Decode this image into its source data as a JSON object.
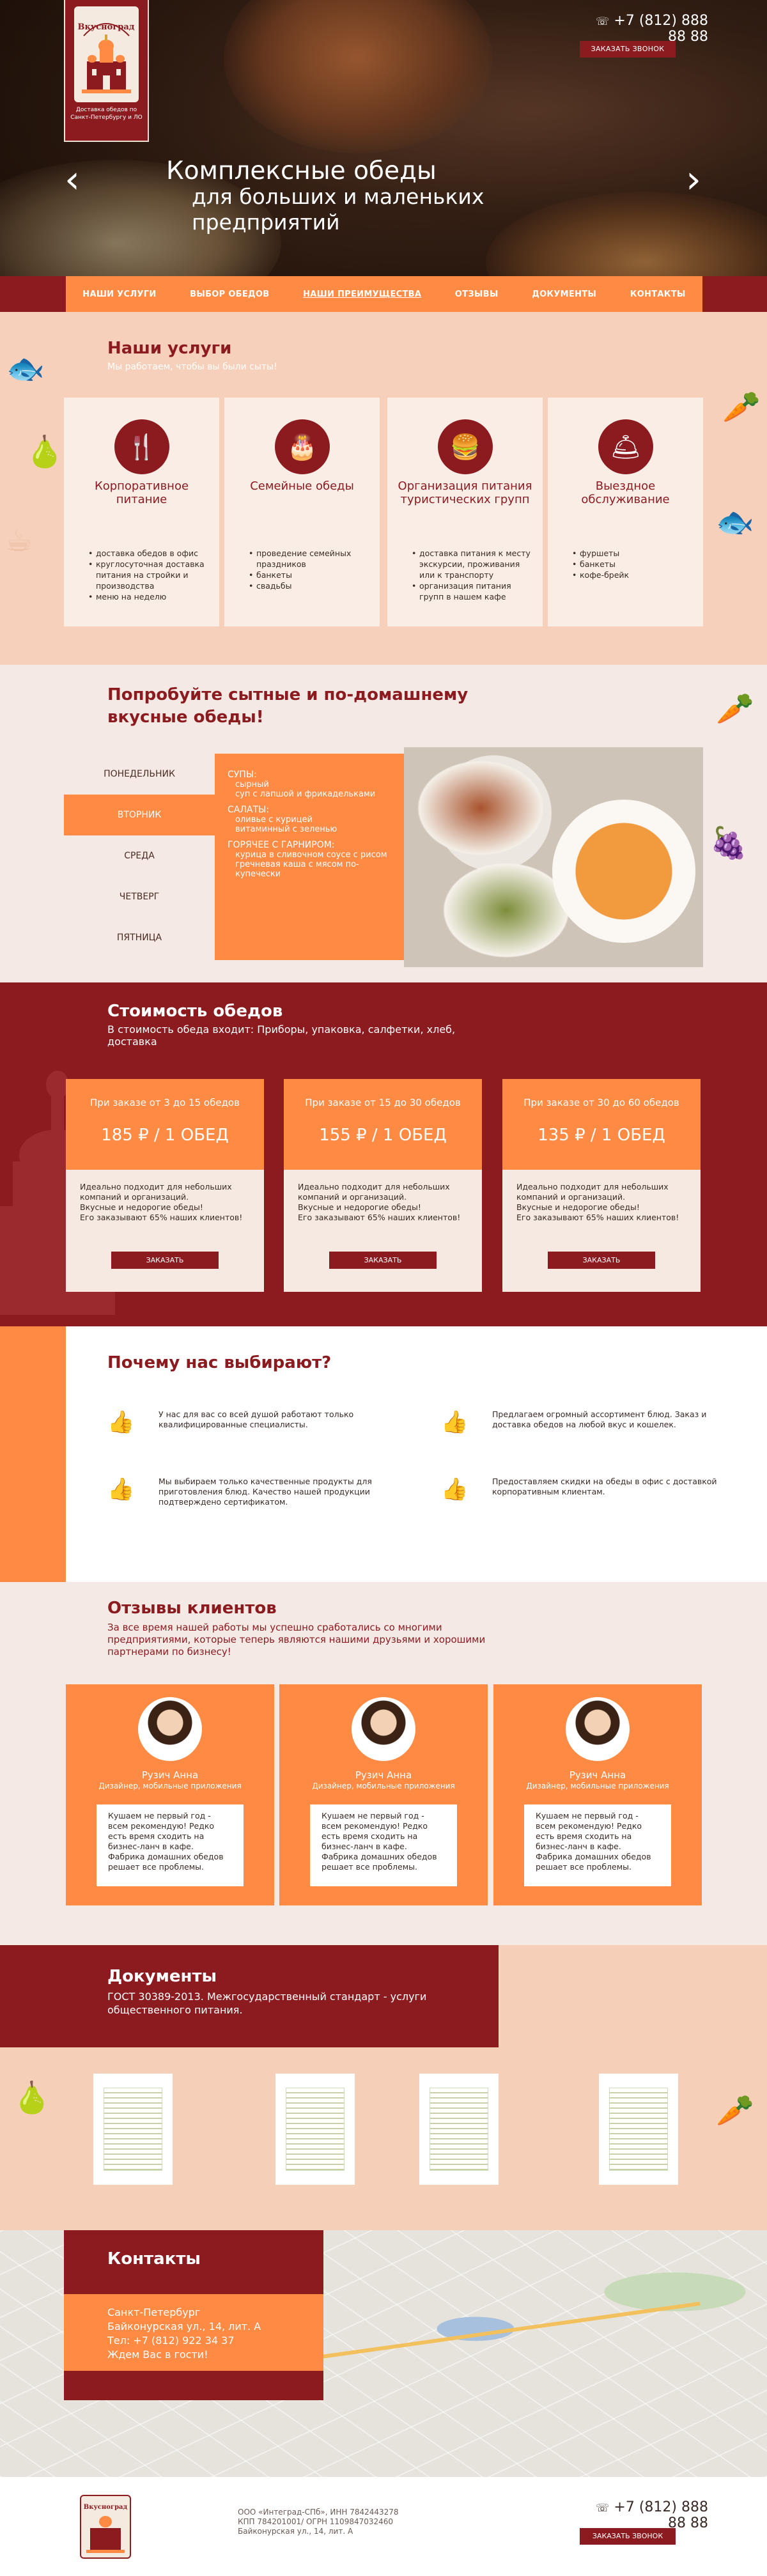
{
  "colors": {
    "burgundy": "#8c1b20",
    "orange": "#ff8a43",
    "peach": "#f6d0ba",
    "cream": "#f4e9e4"
  },
  "header": {
    "logo_title": "Вкусноград",
    "logo_caption": "Доставка обедов по Санкт-Петербургу и ЛО",
    "phone": "+7 (812) 888 88 88",
    "callback": "ЗАКАЗАТЬ ЗВОНОК",
    "prev_icon": "chevron-left-icon",
    "next_icon": "chevron-right-icon"
  },
  "hero": {
    "line1": "Комплексные обеды",
    "line2": "для больших и маленьких",
    "line3": "предприятий"
  },
  "nav": {
    "items": [
      "НАШИ УСЛУГИ",
      "ВЫБОР ОБЕДОВ",
      "НАШИ  ПРЕИМУЩЕСТВА",
      "ОТЗЫВЫ",
      "ДОКУМЕНТЫ",
      "КОНТАКТЫ"
    ],
    "active": 2
  },
  "services": {
    "title": "Наши услуги",
    "subtitle": "Мы работаем, чтобы вы были сыты!",
    "cards": [
      {
        "icon": "cutlery-icon",
        "title": "Корпоративное питание",
        "items": [
          "доставка обедов в офис",
          "круглосуточная доставка питания на стройки и производства",
          "меню на неделю"
        ]
      },
      {
        "icon": "cake-icon",
        "title": "Семейные обеды",
        "items": [
          "проведение семейных праздников",
          "банкеты",
          "свадьбы"
        ]
      },
      {
        "icon": "burger-icon",
        "title": "Организация питания туристических групп",
        "items": [
          "доставка питания к месту экскурсии, проживания или к транспорту",
          "организация питания групп в нашем кафе"
        ]
      },
      {
        "icon": "cloche-icon",
        "title": "Выездное обслуживание",
        "items": [
          "фуршеты",
          "банкеты",
          "кофе-брейк"
        ]
      }
    ]
  },
  "menu": {
    "title1": "Попробуйте сытные и по-домашнему",
    "title2": "вкусные обеды!",
    "days": [
      "ПОНЕДЕЛЬНИК",
      "ВТОРНИК",
      "СРЕДА",
      "ЧЕТВЕРГ",
      "ПЯТНИЦА"
    ],
    "active_day": 1,
    "sections": [
      {
        "name": "СУПЫ:",
        "items": [
          "сырный",
          "суп с лапшой и фрикадельками"
        ]
      },
      {
        "name": "САЛАТЫ:",
        "items": [
          "оливье с курицей",
          "витаминный с зеленью"
        ]
      },
      {
        "name": "ГОРЯЧЕЕ С ГАРНИРОМ:",
        "items": [
          "курица в сливочном соусе с рисом",
          "гречневая каша с мясом по-купечески"
        ]
      }
    ]
  },
  "prices": {
    "title": "Стоимость обедов",
    "subtitle": "В стоимость обеда входит: Приборы, упаковка, салфетки, хлеб, доставка",
    "cards": [
      {
        "qty": "При заказе от 3 до 15 обедов",
        "price": "185 ₽ / 1 ОБЕД"
      },
      {
        "qty": "При заказе от 15 до 30 обедов",
        "price": "155 ₽ / 1 ОБЕД"
      },
      {
        "qty": "При заказе от 30 до 60 обедов",
        "price": "135 ₽ / 1 ОБЕД"
      }
    ],
    "desc1": "Идеально подходит для небольших компаний и организаций.",
    "desc2": "Вкусные и недорогие обеды!",
    "desc3": "Его заказывают 65% наших клиентов!",
    "order": "ЗАКАЗАТЬ"
  },
  "why": {
    "title": "Почему нас выбирают?",
    "items": [
      "У нас для вас со всей душой работают только квалифицированные специалисты.",
      "Предлагаем огромный ассортимент блюд. Заказ и доставка обедов на любой вкус и кошелек.",
      "Мы выбираем только качественные продукты для приготовления блюд. Качество нашей продукции подтверждено сертификатом.",
      "Предоставляем скидки на обеды в офис с доставкой корпоративным клиентам."
    ],
    "icon": "thumbs-up-icon"
  },
  "reviews": {
    "title": "Отзывы клиентов",
    "subtitle": "За все время нашей работы мы успешно сработались со многими предприятиями, которые теперь являются нашими друзьями и хорошими партнерами по бизнесу!",
    "items": [
      {
        "name": "Рузич Анна",
        "role": "Дизайнер, мобильные приложения",
        "text": "Кушаем не первый год - всем рекомендую! Редко есть время сходить на бизнес-ланч в кафе. Фабрика домашних обедов решает все проблемы."
      },
      {
        "name": "Рузич Анна",
        "role": "Дизайнер, мобильные приложения",
        "text": "Кушаем не первый год - всем рекомендую! Редко есть время сходить на бизнес-ланч в кафе. Фабрика домашних обедов решает все проблемы."
      },
      {
        "name": "Рузич Анна",
        "role": "Дизайнер, мобильные приложения",
        "text": "Кушаем не первый год - всем рекомендую! Редко есть время сходить на бизнес-ланч в кафе. Фабрика домашних обедов решает все проблемы."
      }
    ]
  },
  "docs": {
    "title": "Документы",
    "subtitle": "ГОСТ 30389-2013. Межгосударственный стандарт - услуги общественного питания."
  },
  "contacts": {
    "title": "Контакты",
    "city": "Санкт-Петербург",
    "address": "Байконурская ул., 14, лит. А",
    "phone": "Тел: +7 (812) 922 34 37",
    "welcome": "Ждем Вас в гости!"
  },
  "footer": {
    "req1": "ООО «Интеград-СПб», ИНН 7842443278",
    "req2": "КПП 784201001/ ОГРН 1109847032460",
    "req3": "Байконурская ул., 14, лит. А",
    "phone": "+7 (812) 888 88 88",
    "callback": "ЗАКАЗАТЬ ЗВОНОК"
  }
}
